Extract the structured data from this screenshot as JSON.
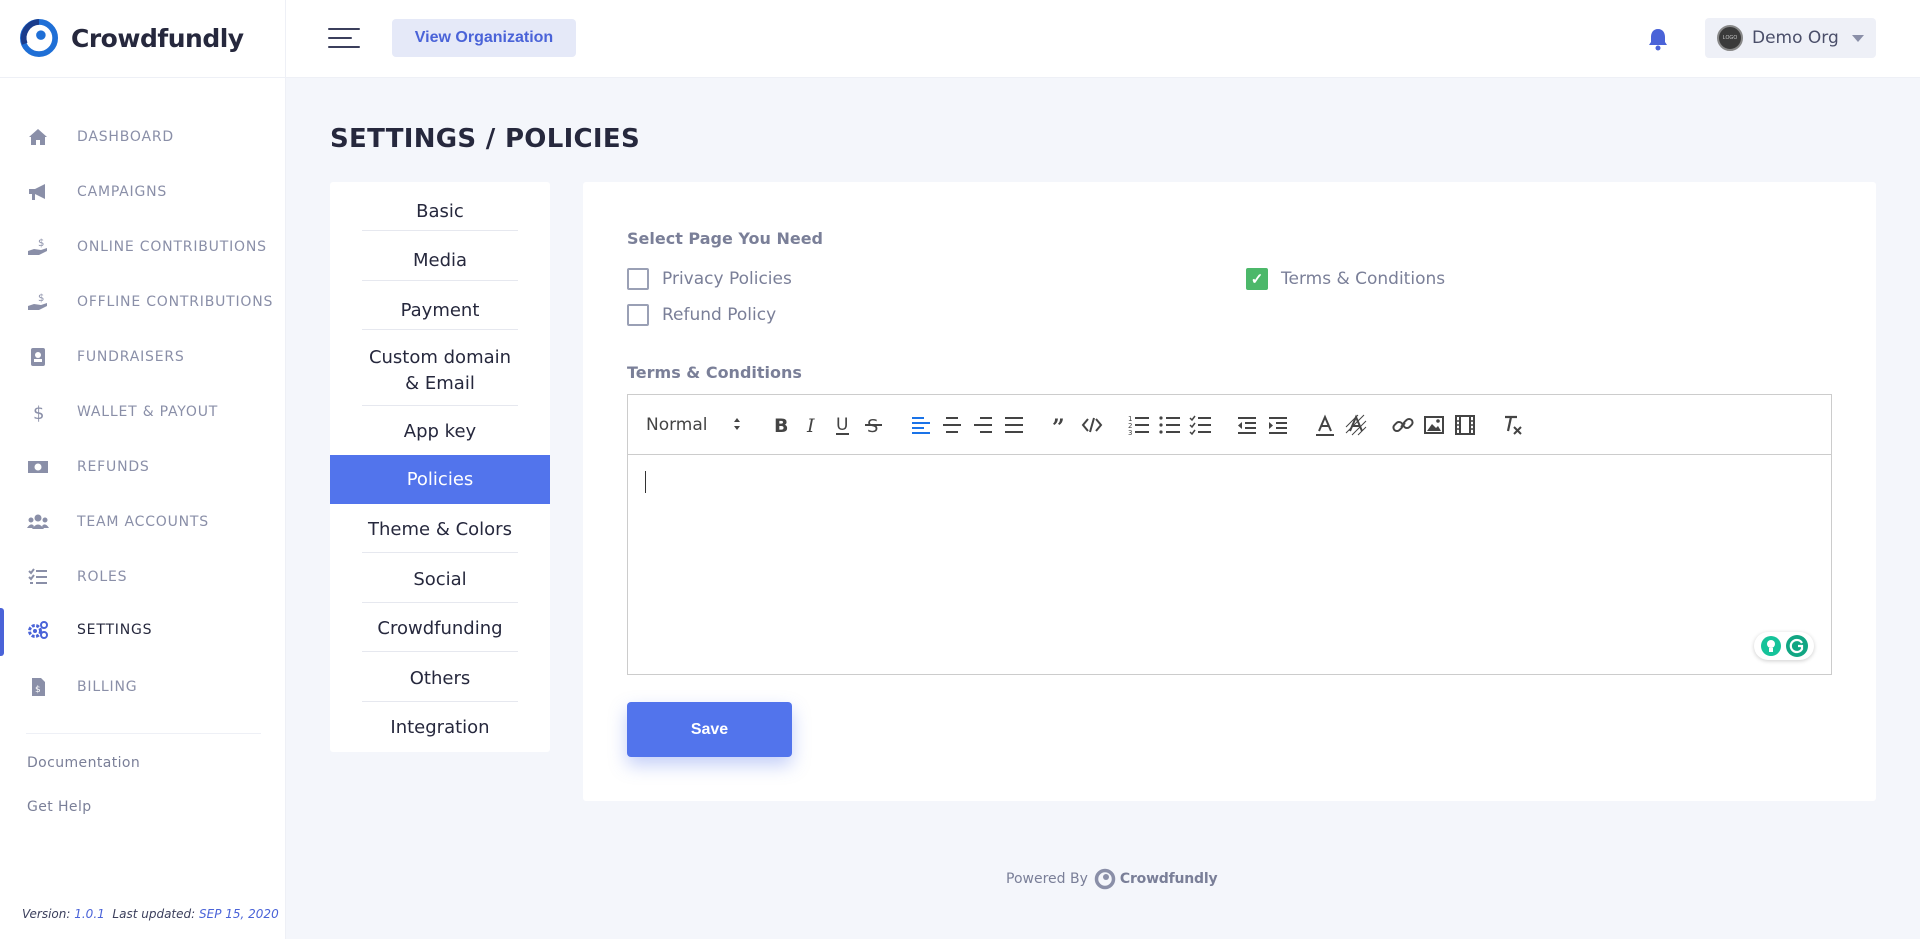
{
  "brand": {
    "name": "Crowdfundly"
  },
  "header": {
    "view_org_label": "View Organization",
    "org_name": "Demo Org",
    "org_avatar_text": "LOGO"
  },
  "sidebar": {
    "items": [
      {
        "label": "DASHBOARD",
        "icon": "home-icon"
      },
      {
        "label": "CAMPAIGNS",
        "icon": "megaphone-icon"
      },
      {
        "label": "ONLINE CONTRIBUTIONS",
        "icon": "hand-dollar-icon"
      },
      {
        "label": "OFFLINE CONTRIBUTIONS",
        "icon": "hand-dollar-icon"
      },
      {
        "label": "FUNDRAISERS",
        "icon": "contact-book-icon"
      },
      {
        "label": "WALLET & PAYOUT",
        "icon": "dollar-icon"
      },
      {
        "label": "REFUNDS",
        "icon": "money-bill-icon"
      },
      {
        "label": "TEAM ACCOUNTS",
        "icon": "users-icon"
      },
      {
        "label": "ROLES",
        "icon": "checklist-icon"
      },
      {
        "label": "SETTINGS",
        "icon": "gears-icon",
        "active": true
      },
      {
        "label": "BILLING",
        "icon": "invoice-icon"
      }
    ],
    "documentation": "Documentation",
    "get_help": "Get Help",
    "version_label": "Version:",
    "version": "1.0.1",
    "updated_label": "Last updated:",
    "updated": "SEP 15, 2020"
  },
  "page": {
    "title": "SETTINGS / POLICIES"
  },
  "settings_menu": {
    "items": [
      "Basic",
      "Media",
      "Payment",
      "Custom domain & Email",
      "App key",
      "Policies",
      "Theme & Colors",
      "Social",
      "Crowdfunding",
      "Others",
      "Integration"
    ],
    "active": "Policies"
  },
  "policies": {
    "select_label": "Select Page You Need",
    "options": [
      {
        "label": "Privacy Policies",
        "checked": false
      },
      {
        "label": "Refund Policy",
        "checked": false
      },
      {
        "label": "Terms & Conditions",
        "checked": true
      }
    ],
    "editor_label": "Terms & Conditions",
    "format_value": "Normal",
    "save_label": "Save"
  },
  "footer": {
    "powered_by": "Powered By",
    "brand": "Crowdfundly"
  },
  "colors": {
    "accent": "#5274ec",
    "check": "#4cb86a",
    "text": "#26283d"
  }
}
